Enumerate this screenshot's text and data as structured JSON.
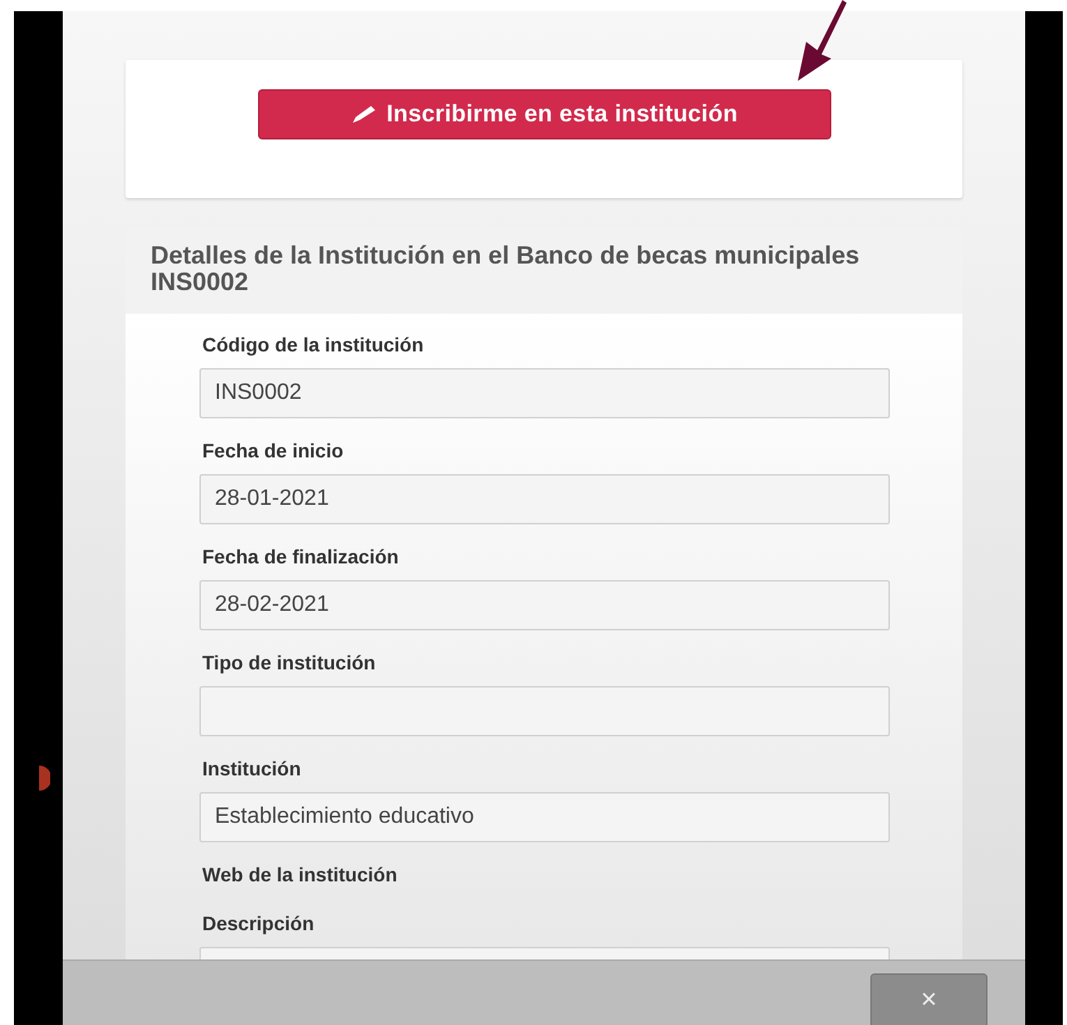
{
  "enroll_button": {
    "label": "Inscribirme en esta institución"
  },
  "details": {
    "title": "Detalles de la Institución en el Banco de becas municipales INS0002",
    "fields": [
      {
        "kind": "field",
        "label": "Código de la institución",
        "value": "INS0002"
      },
      {
        "kind": "field",
        "label": "Fecha de inicio",
        "value": "28-01-2021"
      },
      {
        "kind": "field",
        "label": "Fecha de finalización",
        "value": "28-02-2021"
      },
      {
        "kind": "field",
        "label": "Tipo de institución"
      },
      {
        "kind": "field",
        "label": "Institución",
        "value": "Establecimiento educativo"
      },
      {
        "kind": "label",
        "label": "Web de la institución"
      },
      {
        "kind": "field",
        "label": "Descripción"
      }
    ]
  },
  "footer": {
    "close_button": "×"
  }
}
